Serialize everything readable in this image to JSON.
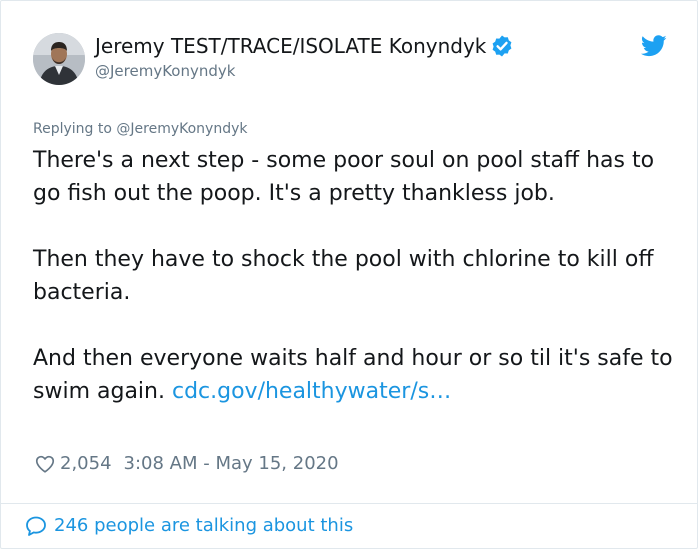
{
  "user": {
    "display_name": "Jeremy TEST/TRACE/ISOLATE Konyndyk",
    "handle": "@JeremyKonyndyk",
    "avatar_icon": "user-avatar",
    "verified_icon": "verified-badge-icon"
  },
  "brand": {
    "icon": "twitter-bird-icon",
    "color": "#1da1f2"
  },
  "reply": {
    "prefix": "Replying to ",
    "handle": "@JeremyKonyndyk"
  },
  "tweet": {
    "paragraph_1": "There's a next step - some poor soul on pool staff has to go fish out the poop. It's a pretty thankless job.",
    "paragraph_2": "Then they have to shock the pool with chlorine to kill off bacteria.",
    "paragraph_3_text": "And then everyone waits half and hour or so til it's safe to swim again. ",
    "paragraph_3_link": "cdc.gov/healthywater/s…"
  },
  "meta": {
    "likes": "2,054",
    "timestamp": "3:08 AM - May 15, 2020"
  },
  "footer": {
    "conversation_label": "246 people are talking about this"
  },
  "colors": {
    "text": "#14171a",
    "secondary": "#657786",
    "link": "#1b95e0",
    "border": "#e1e8ed"
  }
}
